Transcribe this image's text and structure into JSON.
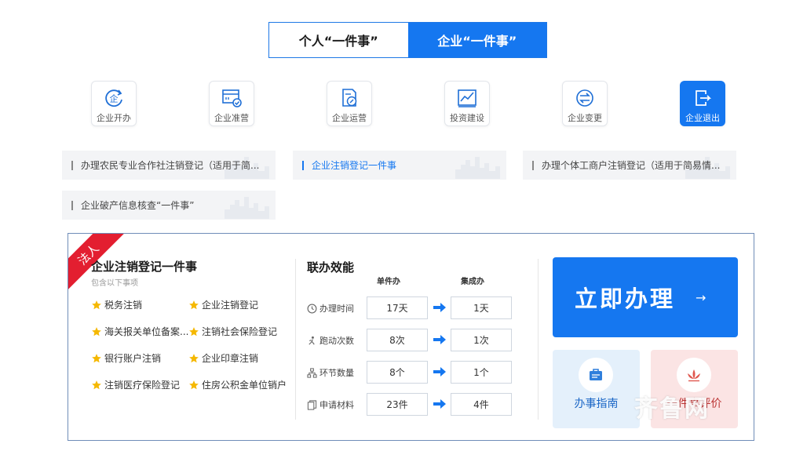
{
  "tabs": [
    {
      "label": "个人“一件事”",
      "active": false
    },
    {
      "label": "企业“一件事”",
      "active": true
    }
  ],
  "categories": [
    {
      "label": "企业开办",
      "icon": "enterprise-start-icon"
    },
    {
      "label": "企业准营",
      "icon": "license-check-icon"
    },
    {
      "label": "企业运营",
      "icon": "document-edit-icon"
    },
    {
      "label": "投资建设",
      "icon": "chart-line-icon"
    },
    {
      "label": "企业变更",
      "icon": "exchange-icon"
    },
    {
      "label": "企业退出",
      "icon": "exit-icon",
      "selected": true
    }
  ],
  "subitems": [
    {
      "label": "办理农民专业合作社注销登记（适用于简..."
    },
    {
      "label": "企业注销登记一件事",
      "active": true
    },
    {
      "label": "办理个体工商户注销登记（适用于简易情..."
    },
    {
      "label": "企业破产信息核查“一件事”"
    }
  ],
  "panel": {
    "ribbon": "法人",
    "title": "企业注销登记一件事",
    "subtitle": "包含以下事项",
    "items": [
      "税务注销",
      "企业注销登记",
      "海关报关单位备案...",
      "注销社会保险登记",
      "银行账户注销",
      "企业印章注销",
      "注销医疗保险登记",
      "住房公积金单位销户"
    ],
    "efficiency": {
      "title": "联办效能",
      "col_single": "单件办",
      "col_combined": "集成办",
      "rows": [
        {
          "label": "办理时间",
          "single": "17天",
          "combined": "1天"
        },
        {
          "label": "跑动次数",
          "single": "8次",
          "combined": "1次"
        },
        {
          "label": "环节数量",
          "single": "8个",
          "combined": "1个"
        },
        {
          "label": "申请材料",
          "single": "23件",
          "combined": "4件"
        }
      ]
    },
    "apply_button": "立即办理",
    "apply_arrow": "→",
    "guide_label": "办事指南",
    "eval_label": "一件事评价"
  },
  "watermark": "齐鲁网",
  "colors": {
    "primary": "#1577f0",
    "ribbon": "#e31e30",
    "star": "#f5b800"
  }
}
